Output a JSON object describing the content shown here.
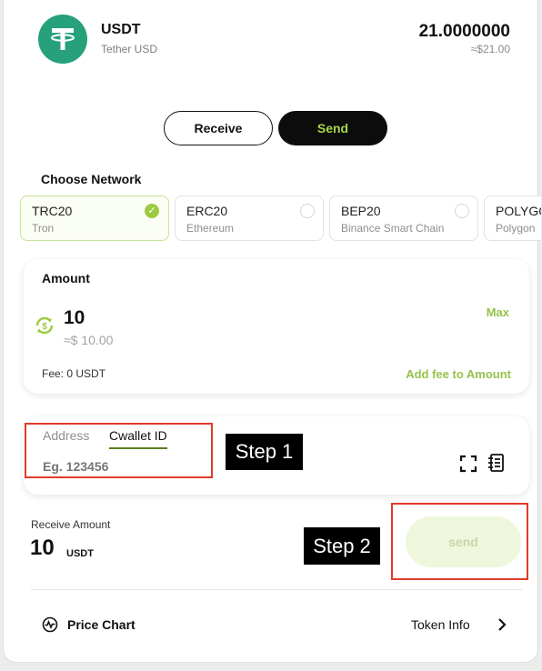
{
  "token": {
    "symbol": "USDT",
    "name": "Tether USD",
    "balance": "21.0000000",
    "balance_usd": "≈$21.00",
    "logo_color": "#26a17b"
  },
  "tabs": {
    "receive_label": "Receive",
    "send_label": "Send"
  },
  "network": {
    "title": "Choose Network",
    "options": [
      {
        "name": "TRC20",
        "chain": "Tron",
        "selected": true
      },
      {
        "name": "ERC20",
        "chain": "Ethereum",
        "selected": false
      },
      {
        "name": "BEP20",
        "chain": "Binance Smart Chain",
        "selected": false
      },
      {
        "name": "POLYGON",
        "chain": "Polygon",
        "selected": false
      }
    ]
  },
  "amount": {
    "title": "Amount",
    "value": "10",
    "value_usd": "≈$ 10.00",
    "max_label": "Max",
    "fee": "Fee: 0 USDT",
    "add_fee_label": "Add fee to Amount"
  },
  "address": {
    "tab_address": "Address",
    "tab_cwallet": "Cwallet ID",
    "placeholder": "Eg. 123456"
  },
  "annotations": {
    "step1": "Step 1",
    "step2": "Step 2"
  },
  "receive": {
    "label": "Receive Amount",
    "value": "10",
    "unit": "USDT",
    "send_button": "send"
  },
  "footer": {
    "price_chart": "Price Chart",
    "token_info": "Token Info"
  },
  "colors": {
    "accent": "#96c24a",
    "annotation": "#e23a2a",
    "send_tab_bg": "#0c0c0c"
  }
}
